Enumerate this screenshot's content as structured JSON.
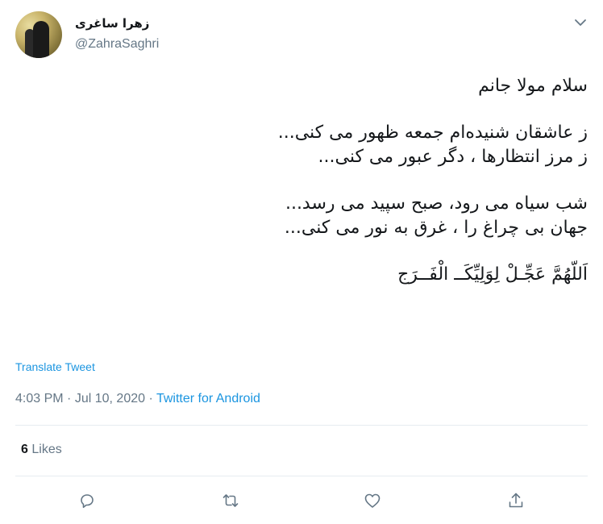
{
  "tweet": {
    "display_name": "زهرا ساغری",
    "handle": "@ZahraSaghri",
    "lines": [
      "سلام مولا جانم",
      "ز عاشقان شنیده‌ام جمعه ظهور می کنی...",
      "ز مرز انتظارها ، دگر عبور می کنی...",
      "شب سیاه می رود، صبح سپید می رسد...",
      "جهان بی چراغ را ، غرق به نور می کنی...",
      "اَللّهُمَّ عَجِّـلْ لِوَلِیِّکَــ الْفَــرَج"
    ],
    "translate_label": "Translate Tweet",
    "time": "4:03 PM",
    "separator": "·",
    "date": "Jul 10, 2020",
    "source": "Twitter for Android",
    "likes_count": "6",
    "likes_label": "Likes"
  },
  "colors": {
    "link": "#1b95e0",
    "muted": "#657786",
    "text": "#14171a",
    "divider": "#e6ecf0"
  },
  "icons": {
    "caret": "chevron-down-icon",
    "reply": "reply-icon",
    "retweet": "retweet-icon",
    "like": "heart-icon",
    "share": "share-icon"
  }
}
